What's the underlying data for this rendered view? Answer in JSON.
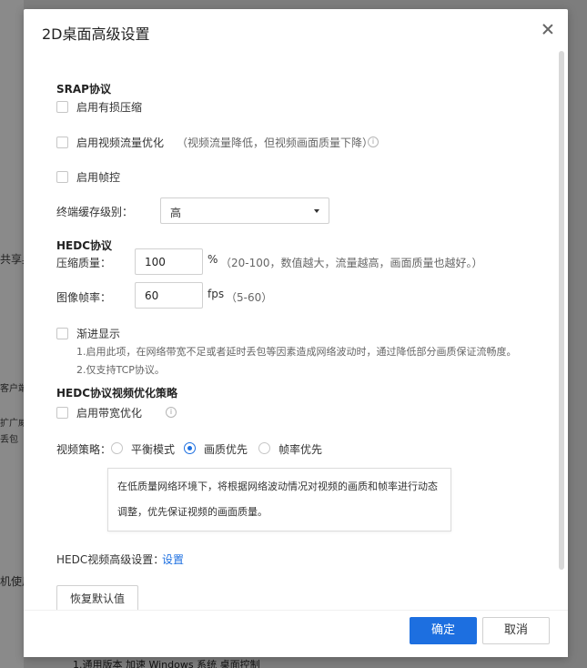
{
  "background": {
    "fragments": [
      "共享桌",
      "客户端",
      "扩广威",
      "丢包",
      "机使用"
    ],
    "bottom_text": "1.通用版本  加速 Windows 系统 桌面控制"
  },
  "dialog": {
    "title": "2D桌面高级设置",
    "srap": {
      "section_title": "SRAP协议",
      "lossy_compression": "启用有损压缩",
      "video_flow_optimize": "启用视频流量优化",
      "video_flow_hint": "（视频流量降低，但视频画面质量下降）",
      "frame_control": "启用帧控",
      "cache_level_label": "终端缓存级别：",
      "cache_level_value": "高"
    },
    "hedc": {
      "section_title": "HEDC协议",
      "compression_label": "压缩质量：",
      "compression_value": "100",
      "compression_unit": "%",
      "compression_hint": "（20-100，数值越大，流量越高，画面质量也越好。）",
      "framerate_label": "图像帧率：",
      "framerate_value": "60",
      "framerate_unit": "fps",
      "framerate_hint": "（5-60）",
      "progressive_label": "渐进显示",
      "progressive_note1": "1.启用此项，在网络带宽不足或者延时丢包等因素造成网络波动时，通过降低部分画质保证流畅度。",
      "progressive_note2": "2.仅支持TCP协议。"
    },
    "strategy": {
      "section_title": "HEDC协议视频优化策略",
      "bandwidth_optimize": "启用带宽优化",
      "video_strategy_label": "视频策略：",
      "options": [
        "平衡模式",
        "画质优先",
        "帧率优先"
      ],
      "selected": "画质优先",
      "tip_line1": "在低质量网络环境下，将根据网络波动情况对视频的画质和帧率进行动态",
      "tip_line2": "调整，优先保证视频的画面质量。"
    },
    "advanced": {
      "label": "HEDC视频高级设置：",
      "link": "设置"
    },
    "restore_button": "恢复默认值",
    "ok_button": "确定",
    "cancel_button": "取消"
  },
  "colors": {
    "accent": "#1d6fe0"
  }
}
